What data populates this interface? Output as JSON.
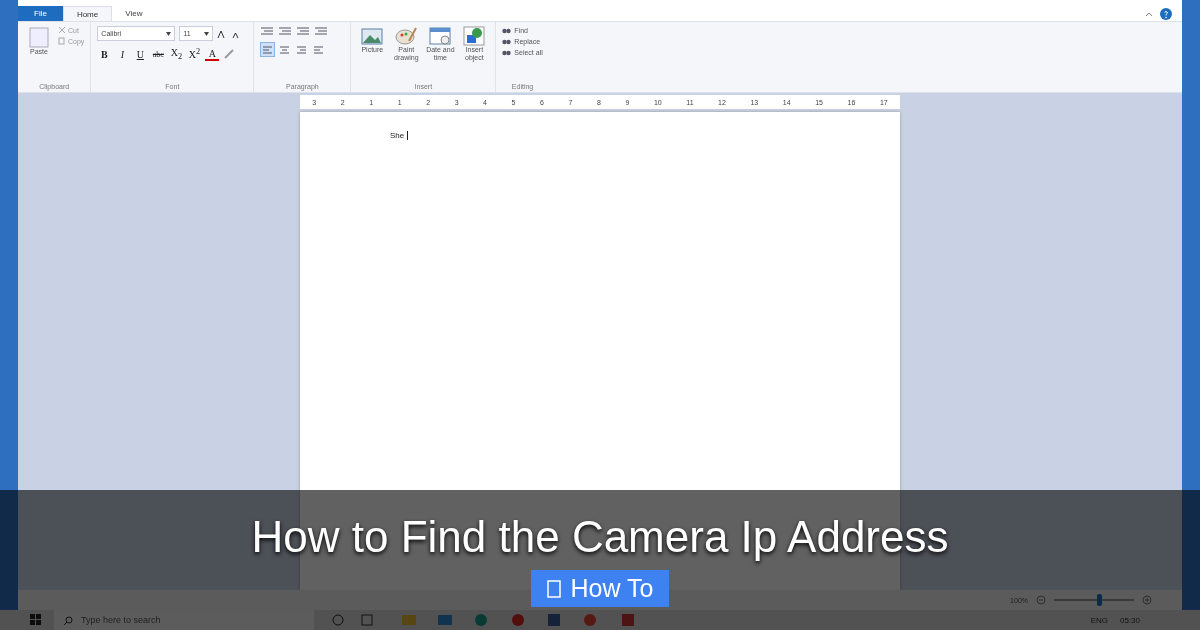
{
  "tabs": [
    {
      "label": "File",
      "kind": "file",
      "selected": false
    },
    {
      "label": "Home",
      "kind": "tab",
      "selected": true
    },
    {
      "label": "View",
      "kind": "tab",
      "selected": false
    }
  ],
  "clipboard": {
    "paste": "Paste",
    "cut": "Cut",
    "copy": "Copy",
    "group": "Clipboard"
  },
  "font": {
    "family": "Calibri",
    "size": "11",
    "group": "Font",
    "buttons": [
      {
        "label": "B",
        "kind": "bold"
      },
      {
        "label": "I",
        "kind": "italic"
      },
      {
        "label": "U",
        "kind": "underline"
      },
      {
        "label": "abc",
        "kind": "strike"
      },
      {
        "label": "X$_{2}$",
        "kind": "plain"
      },
      {
        "label": "X$^{2}$",
        "kind": "plain"
      },
      {
        "label": "A",
        "kind": "color"
      }
    ]
  },
  "paragraph": {
    "group": "Paragraph",
    "alignments": [
      {
        "selected": true
      },
      {
        "selected": false
      },
      {
        "selected": false
      },
      {
        "selected": false
      }
    ]
  },
  "insert": {
    "group": "Insert",
    "items": [
      {
        "label": "Picture",
        "kind": "picture"
      },
      {
        "label": "Paint drawing",
        "kind": "paint"
      },
      {
        "label": "Date and time",
        "kind": "date"
      },
      {
        "label": "Insert object",
        "kind": "object"
      }
    ]
  },
  "editing": {
    "group": "Editing",
    "items": [
      "Find",
      "Replace",
      "Select all"
    ]
  },
  "ruler_labels": [
    "3",
    "2",
    "1",
    "1",
    "2",
    "3",
    "4",
    "5",
    "6",
    "7",
    "8",
    "9",
    "10",
    "11",
    "12",
    "13",
    "14",
    "15",
    "16",
    "17"
  ],
  "document": {
    "text": "She"
  },
  "overlay": {
    "title": "How to Find the Camera Ip Address",
    "button": "How To"
  },
  "status_bar": {
    "zoom": "100%",
    "level": 0.58
  },
  "taskbar": {
    "search_placeholder": "Type here to search",
    "language": "ENG",
    "time": "05:30"
  }
}
